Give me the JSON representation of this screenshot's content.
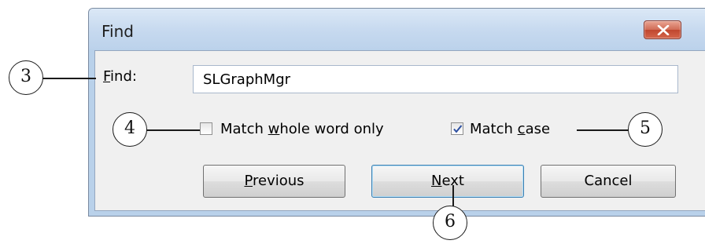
{
  "dialog": {
    "title": "Find",
    "close_icon": "close-x-icon",
    "find_label": {
      "mnemonic": "F",
      "rest": "ind:"
    },
    "find_value": "SLGraphMgr",
    "whole_word": {
      "before": "Match ",
      "mnemonic": "w",
      "after": "hole word only",
      "checked": false
    },
    "match_case": {
      "before": "Match ",
      "mnemonic": "c",
      "after": "ase",
      "checked": true
    },
    "buttons": {
      "previous": {
        "mnemonic": "P",
        "rest": "revious"
      },
      "next": {
        "mnemonic": "N",
        "rest": "ext"
      },
      "cancel": "Cancel"
    }
  },
  "callouts": {
    "c3": "3",
    "c4": "4",
    "c5": "5",
    "c6": "6"
  },
  "colors": {
    "title_bar": "#c6d9ef",
    "close_button": "#c0462f",
    "client": "#f0f0f0"
  }
}
